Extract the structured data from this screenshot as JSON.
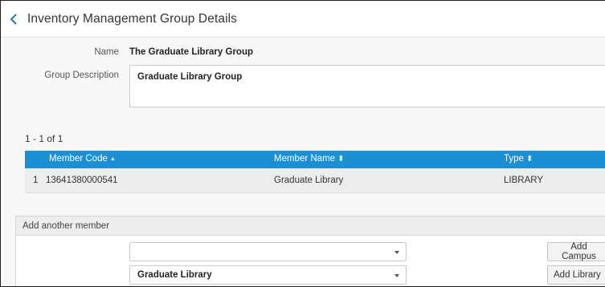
{
  "header": {
    "title": "Inventory Management Group Details"
  },
  "form": {
    "name_label": "Name",
    "name_value": "The Graduate Library Group",
    "description_label": "Group Description",
    "description_value": "Graduate Library Group"
  },
  "table": {
    "count": "1 - 1 of 1",
    "columns": {
      "member_code": "Member Code",
      "member_name": "Member Name",
      "type": "Type"
    },
    "sort_icons": {
      "member_code": "▲",
      "member_name": "⬍",
      "type": "⬍"
    },
    "rows": [
      {
        "index": "1",
        "member_code": "13641380000541",
        "member_name": "Graduate Library",
        "type": "LIBRARY"
      }
    ]
  },
  "add_member": {
    "title": "Add another member",
    "campus_select_value": "",
    "library_select_value": "Graduate Library",
    "add_campus_label": "Add Campus",
    "add_library_label": "Add Library"
  },
  "colors": {
    "table_header": "#1a8fd6",
    "back_arrow": "#1a7cc1"
  },
  "icons": {
    "back": "chevron-left-icon",
    "dropdown": "caret-down-icon"
  }
}
